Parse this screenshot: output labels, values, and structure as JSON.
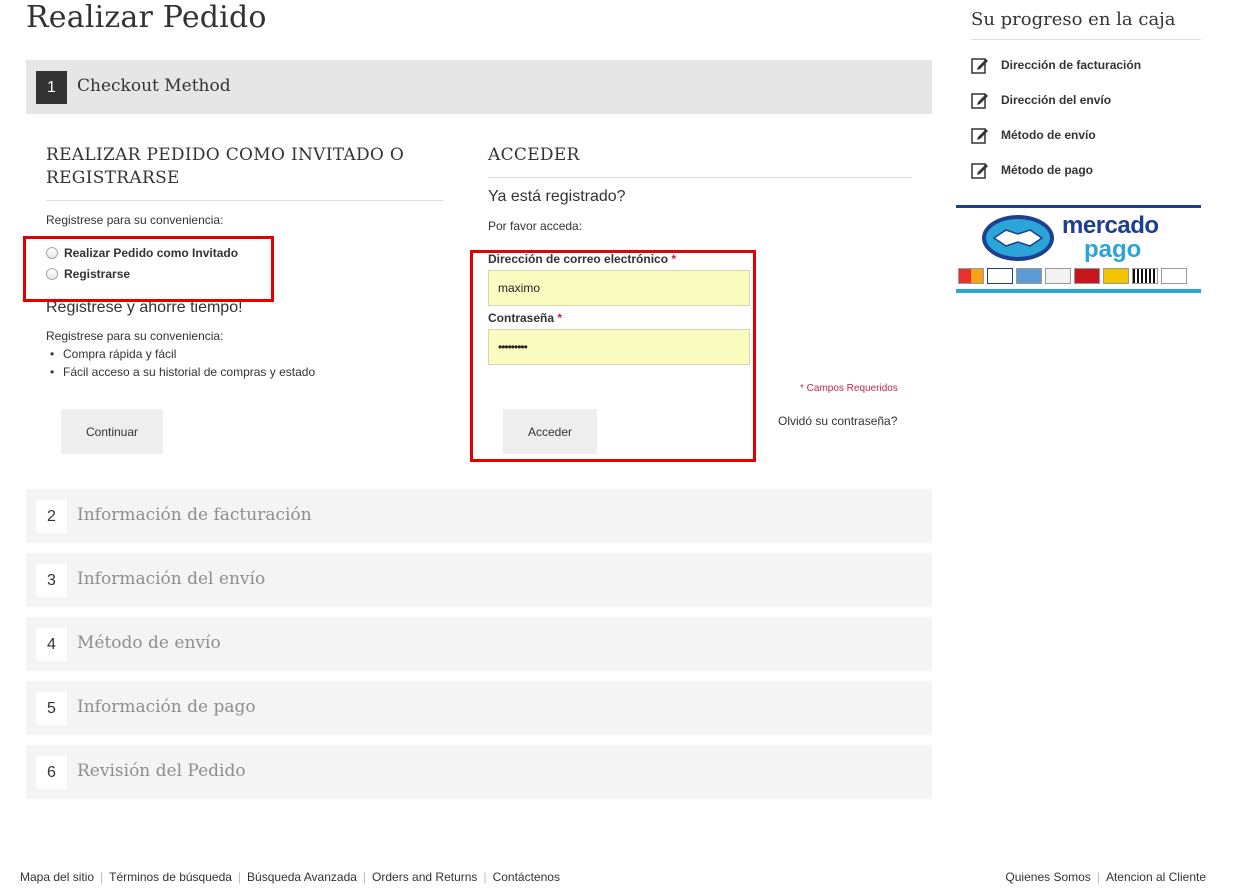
{
  "page": {
    "title": "Realizar Pedido"
  },
  "steps": [
    {
      "num": "1",
      "label": "Checkout Method",
      "active": true
    },
    {
      "num": "2",
      "label": "Información de facturación"
    },
    {
      "num": "3",
      "label": "Información del envío"
    },
    {
      "num": "4",
      "label": "Método de envío"
    },
    {
      "num": "5",
      "label": "Información de pago"
    },
    {
      "num": "6",
      "label": "Revisión del Pedido"
    }
  ],
  "guest": {
    "title_line1": "REALIZAR PEDIDO COMO INVITADO O",
    "title_line2": "REGISTRARSE",
    "intro": "Registrese para su conveniencia:",
    "option_guest": "Realizar Pedido como Invitado",
    "option_register": "Registrarse",
    "save_time": "Registrese y ahorre tiempo!",
    "benefits_intro": "Registrese para su conveniencia:",
    "benefits": [
      "Compra rápida y fácil",
      "Fácil acceso a su historial de compras y estado"
    ],
    "continue_label": "Continuar"
  },
  "login": {
    "title": "ACCEDER",
    "subtitle": "Ya está registrado?",
    "prompt": "Por favor acceda:",
    "email_label": "Dirección de correo electrónico",
    "email_value": "maximo",
    "password_label": "Contraseña",
    "password_value": "•••••••••",
    "required_mark": "*",
    "required_note": "* Campos Requeridos",
    "forgot": "Olvidó su contraseña?",
    "submit_label": "Acceder"
  },
  "sidebar": {
    "title": "Su progreso en la caja",
    "items": [
      "Dirección de facturación",
      "Dirección del envío",
      "Método de envío",
      "Método de pago"
    ]
  },
  "mercado_pago": {
    "line1": "mercado",
    "line2": "pago"
  },
  "footer": {
    "left": [
      "Mapa del sitio",
      "Términos de búsqueda",
      "Búsqueda Avanzada",
      "Orders and Returns",
      "Contáctenos"
    ],
    "right": [
      "Quienes Somos",
      "Atencion al Cliente"
    ]
  },
  "colors": {
    "highlight": "#e00000",
    "input_bg": "#fbfcbf",
    "required": "#c7254e",
    "brand_blue": "#1d3f8f",
    "brand_cyan": "#2aa5d8"
  }
}
